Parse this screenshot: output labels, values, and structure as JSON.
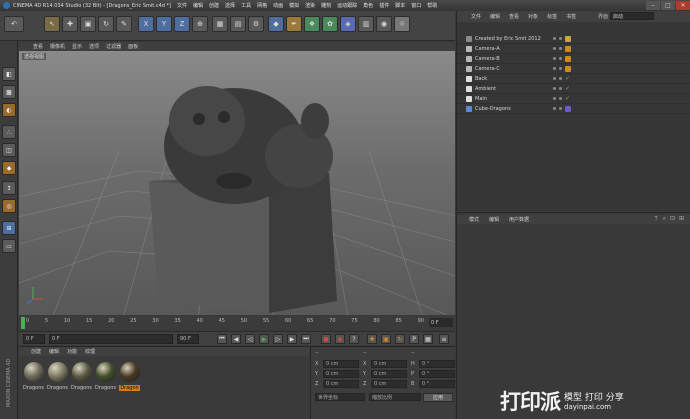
{
  "window": {
    "title": "CINEMA 4D R14.034 Studio (32 Bit) - [Dragons_Eric Smit.c4d *]",
    "menus": [
      "文件",
      "编辑",
      "创建",
      "选择",
      "工具",
      "网格",
      "动画",
      "模拟",
      "渲染",
      "雕刻",
      "运动跟踪",
      "角色",
      "插件",
      "脚本",
      "窗口",
      "帮助"
    ]
  },
  "toolbar": {
    "buttons": [
      "undo",
      "select",
      "move",
      "scale",
      "rotate",
      "x",
      "y",
      "z",
      "coord",
      "render-region",
      "render",
      "render-settings",
      "cube",
      "pen",
      "subdivide",
      "array",
      "deformer",
      "scene",
      "camera",
      "light"
    ]
  },
  "viewport": {
    "menu": [
      "查看",
      "摄像机",
      "显示",
      "选项",
      "过滤器",
      "面板"
    ],
    "label": "透视视图",
    "axis_label": "Z"
  },
  "timeline": {
    "ticks": [
      "0",
      "5",
      "10",
      "15",
      "20",
      "25",
      "30",
      "35",
      "40",
      "45",
      "50",
      "55",
      "60",
      "65",
      "70",
      "75",
      "80",
      "85",
      "90"
    ],
    "frame": "0 F"
  },
  "playbar": {
    "start": "0 F",
    "current": "0 F",
    "end": "90 F",
    "end2": "90 F"
  },
  "materials": {
    "menu": [
      "创建",
      "编辑",
      "功能",
      "纹理"
    ],
    "items": [
      {
        "name": "Dragons",
        "color": "#6e6a58",
        "selected": false
      },
      {
        "name": "Dragons",
        "color": "#7c7a62",
        "selected": false
      },
      {
        "name": "Dragons",
        "color": "#5b5a44",
        "selected": false
      },
      {
        "name": "Dragons",
        "color": "#44502c",
        "selected": false
      },
      {
        "name": "Dragon",
        "color": "#4a3a26",
        "selected": true
      }
    ]
  },
  "coordinates": {
    "header": [
      "--",
      "--",
      "--"
    ],
    "rows": [
      {
        "a": "X",
        "av": "0 cm",
        "b": "X",
        "bv": "0 cm",
        "c": "H",
        "cv": "0 °"
      },
      {
        "a": "Y",
        "av": "0 cm",
        "b": "Y",
        "bv": "0 cm",
        "c": "P",
        "cv": "0 °"
      },
      {
        "a": "Z",
        "av": "0 cm",
        "b": "Z",
        "bv": "0 cm",
        "c": "B",
        "cv": "0 °"
      }
    ],
    "mode": "世界坐标",
    "size_mode": "缩放比例",
    "apply": "应用"
  },
  "objects": {
    "menu": [
      "文件",
      "编辑",
      "查看",
      "对象",
      "标签",
      "书签"
    ],
    "layout_label": "界面",
    "layout_value": "启动",
    "rows": [
      {
        "name": "Created by Eric Smit 2012",
        "icon_color": "#8a8a8a",
        "check": false,
        "tag": "#c8a640"
      },
      {
        "name": "Camera-A",
        "icon_color": "#b8b8b8",
        "check": false,
        "tag": "#d08a1a"
      },
      {
        "name": "Camera-B",
        "icon_color": "#b8b8b8",
        "check": false,
        "tag": "#d08a1a"
      },
      {
        "name": "Camera-C",
        "icon_color": "#b8b8b8",
        "check": false,
        "tag": "#d08a1a"
      },
      {
        "name": "Back",
        "icon_color": "#e0e0e0",
        "check": true,
        "tag": ""
      },
      {
        "name": "Ambient",
        "icon_color": "#e0e0e0",
        "check": true,
        "tag": ""
      },
      {
        "name": "Main",
        "icon_color": "#e0e0e0",
        "check": true,
        "tag": ""
      },
      {
        "name": "Cube-Dragons",
        "icon_color": "#5b8ad8",
        "check": false,
        "tag": "#6a5acd"
      }
    ]
  },
  "attributes": {
    "menu": [
      "模式",
      "编辑",
      "用户数据"
    ]
  },
  "side_brand": "MAXON CINEMA 4D",
  "watermark": {
    "main": "打印派",
    "line1": "模型 打印 分享",
    "line2": "dayinpai.com"
  }
}
